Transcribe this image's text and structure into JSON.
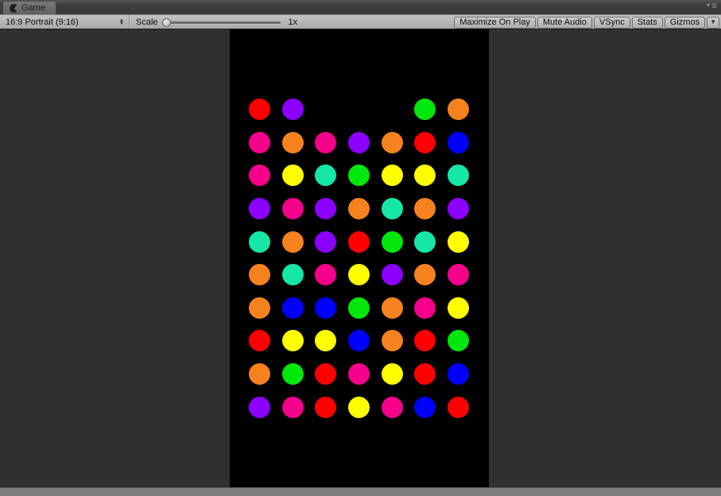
{
  "window": {
    "tab_label": "Game",
    "tab_icon": "unity-game-icon",
    "panel_menu": {
      "caret_glyph": "▾",
      "burger_glyph": "≡"
    }
  },
  "toolbar": {
    "aspect_dropdown": {
      "value": "16:9 Portrait (9:16)",
      "stepper_up": "▲",
      "stepper_down": "▼"
    },
    "scale_label": "Scale",
    "scale_value": "1x",
    "scale_slider_position": 0,
    "buttons": [
      {
        "label": "Maximize On Play"
      },
      {
        "label": "Mute Audio"
      },
      {
        "label": "VSync"
      },
      {
        "label": "Stats"
      },
      {
        "label": "Gizmos"
      }
    ],
    "gizmos_arrow_glyph": "▼"
  },
  "game": {
    "screen_bg": "#000000",
    "viewport_bg": "#303030",
    "palette": {
      "red": "#ff0000",
      "purple": "#8c00ff",
      "green": "#00e70b",
      "orange": "#f5821f",
      "magenta": "#f5008b",
      "yellow": "#ffff00",
      "teal": "#16e7a6",
      "blue": "#0000ff"
    },
    "grid": {
      "cols": 7,
      "rows": 10,
      "cells": [
        [
          "red",
          "purple",
          null,
          null,
          null,
          "green",
          "orange"
        ],
        [
          "magenta",
          "orange",
          "magenta",
          "purple",
          "orange",
          "red",
          "blue"
        ],
        [
          "magenta",
          "yellow",
          "teal",
          "green",
          "yellow",
          "yellow",
          "teal"
        ],
        [
          "purple",
          "magenta",
          "purple",
          "orange",
          "teal",
          "orange",
          "purple"
        ],
        [
          "teal",
          "orange",
          "purple",
          "red",
          "green",
          "teal",
          "yellow"
        ],
        [
          "orange",
          "teal",
          "magenta",
          "yellow",
          "purple",
          "orange",
          "magenta"
        ],
        [
          "orange",
          "blue",
          "blue",
          "green",
          "orange",
          "magenta",
          "yellow"
        ],
        [
          "red",
          "yellow",
          "yellow",
          "blue",
          "orange",
          "red",
          "green"
        ],
        [
          "orange",
          "green",
          "red",
          "magenta",
          "yellow",
          "red",
          "blue"
        ],
        [
          "purple",
          "magenta",
          "red",
          "yellow",
          "magenta",
          "blue",
          "red"
        ]
      ]
    }
  }
}
